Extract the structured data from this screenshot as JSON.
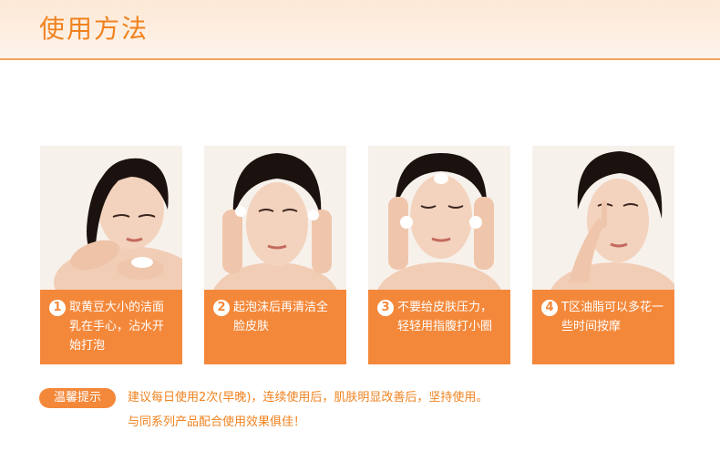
{
  "title": "使用方法",
  "steps": [
    {
      "num": "1",
      "text": "取黄豆大小的洁面\n乳在手心，沾水开\n始打泡"
    },
    {
      "num": "2",
      "text": "起泡沫后再清洁全\n脸皮肤"
    },
    {
      "num": "3",
      "text": "不要给皮肤压力，\n轻轻用指腹打小圈"
    },
    {
      "num": "4",
      "text": "T区油脂可以多花一\n些时间按摩"
    }
  ],
  "tips": {
    "badge": "温馨提示",
    "line1": "建议每日使用2次(早晚)，连续使用后，肌肤明显改善后，坚持使用。",
    "line2": "与同系列产品配合使用效果俱佳！"
  },
  "colors": {
    "accent": "#f4883a",
    "title": "#f0821e",
    "header_bg": "#fde9d6"
  }
}
